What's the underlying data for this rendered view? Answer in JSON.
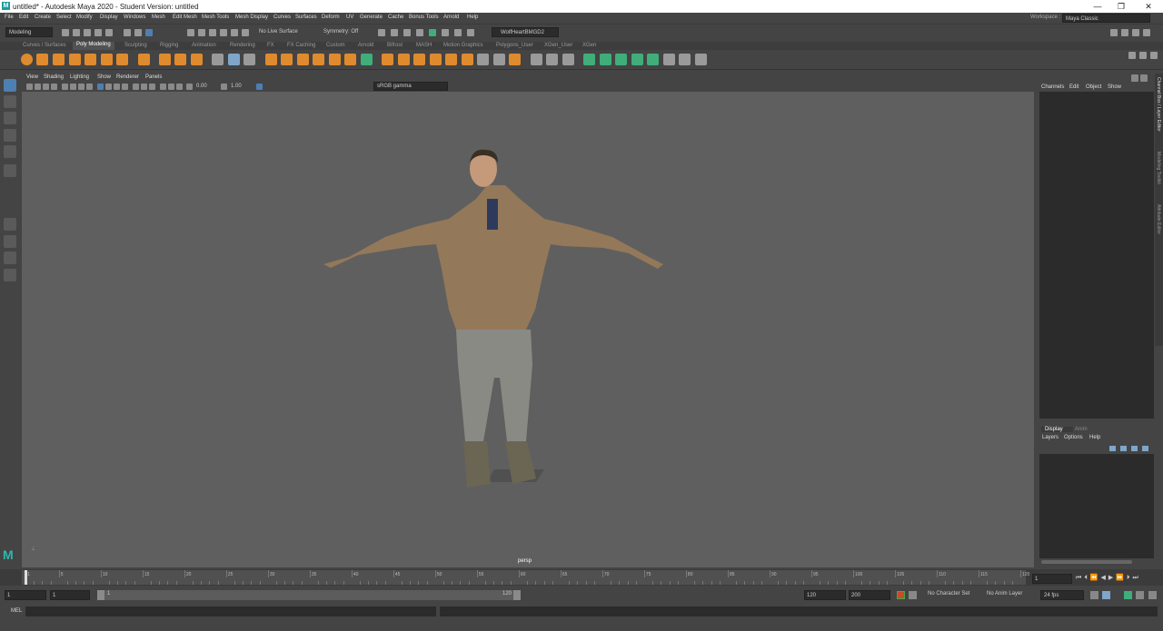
{
  "title_bar": {
    "title": "untitled* - Autodesk Maya 2020 - Student Version: untitled",
    "logo": "M"
  },
  "window_controls": {
    "minimize": "—",
    "maximize": "❐",
    "close": "✕"
  },
  "menu": [
    "File",
    "Edit",
    "Create",
    "Select",
    "Modify",
    "Display",
    "Windows",
    "Mesh",
    "Edit Mesh",
    "Mesh Tools",
    "Mesh Display",
    "Curves",
    "Surfaces",
    "Deform",
    "UV",
    "Generate",
    "Cache",
    "Bonus Tools",
    "Arnold",
    "Help"
  ],
  "workspace": {
    "label": "Workspace :",
    "value": "Maya Classic"
  },
  "status_line": {
    "menu_set": "Modeling",
    "live_surface": "No Live Surface",
    "symmetry": "Symmetry: Off",
    "user": "WolfHeartBMGD2"
  },
  "shelf_tabs": [
    "Curves / Surfaces",
    "Poly Modeling",
    "Sculpting",
    "Rigging",
    "Animation",
    "Rendering",
    "FX",
    "FX Caching",
    "Custom",
    "Arnold",
    "Bifrost",
    "MASH",
    "Motion Graphics",
    "Polygons_User",
    "XGen_User",
    "XGen"
  ],
  "active_shelf": "Poly Modeling",
  "panel_menu": [
    "View",
    "Shading",
    "Lighting",
    "Show",
    "Renderer",
    "Panels"
  ],
  "panel_toolbar": {
    "exposure": "0.00",
    "gamma": "1.00",
    "color_space": "sRGB gamma"
  },
  "viewport": {
    "camera": "persp"
  },
  "channel_box": {
    "menu": [
      "Channels",
      "Edit",
      "Object",
      "Show"
    ]
  },
  "layer_editor": {
    "tabs": [
      "Display",
      "Anim"
    ],
    "menu": [
      "Layers",
      "Options",
      "Help"
    ]
  },
  "side_tabs": [
    "Channel Box / Layer Editor",
    "Modeling Toolkit",
    "Attribute Editor"
  ],
  "time_slider": {
    "ticks": [
      "1",
      "5",
      "10",
      "15",
      "20",
      "25",
      "30",
      "35",
      "40",
      "45",
      "50",
      "55",
      "60",
      "65",
      "70",
      "75",
      "80",
      "85",
      "90",
      "95",
      "100",
      "105",
      "110",
      "115",
      "120"
    ],
    "current_frame": "1"
  },
  "range": {
    "start": "1",
    "anim_start": "1",
    "range_start": "1",
    "range_end": "120",
    "end": "120",
    "anim_end": "200",
    "character_set": "No Character Set",
    "anim_layer": "No Anim Layer",
    "fps": "24 fps"
  },
  "command_line": {
    "label": "MEL"
  },
  "colors": {
    "accent_blue": "#4d7fb2",
    "shelf_orange": "#e08a2e",
    "shelf_green": "#3fae7a",
    "viewport_bg": "#5f5f5f"
  }
}
